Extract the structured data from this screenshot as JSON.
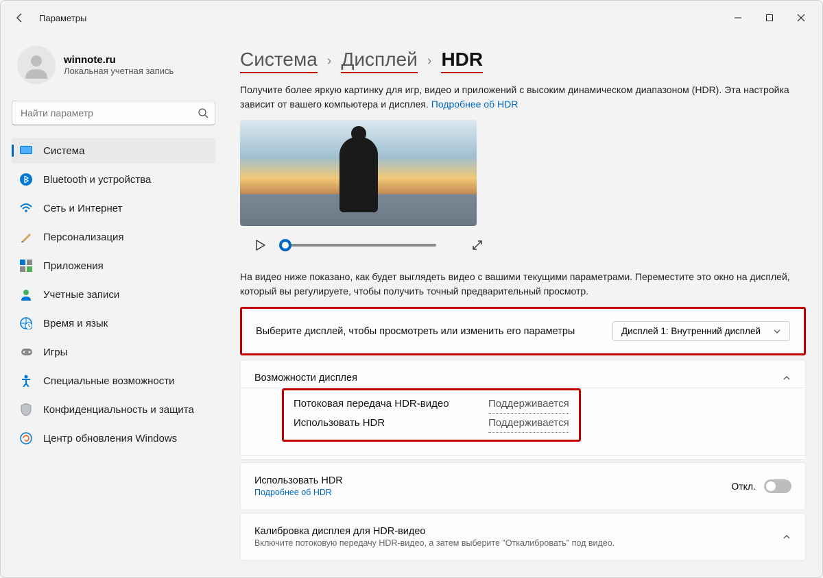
{
  "window": {
    "title": "Параметры"
  },
  "profile": {
    "name": "winnote.ru",
    "subtitle": "Локальная учетная запись"
  },
  "search": {
    "placeholder": "Найти параметр"
  },
  "nav": [
    {
      "label": "Система",
      "icon": "system"
    },
    {
      "label": "Bluetooth и устройства",
      "icon": "bluetooth"
    },
    {
      "label": "Сеть и Интернет",
      "icon": "wifi"
    },
    {
      "label": "Персонализация",
      "icon": "brush"
    },
    {
      "label": "Приложения",
      "icon": "apps"
    },
    {
      "label": "Учетные записи",
      "icon": "person"
    },
    {
      "label": "Время и язык",
      "icon": "globe-clock"
    },
    {
      "label": "Игры",
      "icon": "gamepad"
    },
    {
      "label": "Специальные возможности",
      "icon": "accessibility"
    },
    {
      "label": "Конфиденциальность и защита",
      "icon": "shield"
    },
    {
      "label": "Центр обновления Windows",
      "icon": "update"
    }
  ],
  "breadcrumb": {
    "l1": "Система",
    "l2": "Дисплей",
    "l3": "HDR"
  },
  "desc": {
    "text": "Получите более яркую картинку для игр, видео и приложений с высоким динамическом диапазоном (HDR). Эта настройка зависит от вашего компьютера и дисплея. ",
    "link": "Подробнее об HDR"
  },
  "video_hint": "На видео ниже показано, как будет выглядеть видео с вашими текущими параметрами. Переместите это окно на дисплей, который вы регулируете, чтобы получить точный предварительный просмотр.",
  "display_select": {
    "label": "Выберите дисплей, чтобы просмотреть или изменить его параметры",
    "value": "Дисплей 1: Внутренний дисплей"
  },
  "capabilities": {
    "header": "Возможности дисплея",
    "rows": [
      {
        "label": "Потоковая передача HDR-видео",
        "value": "Поддерживается"
      },
      {
        "label": "Использовать HDR",
        "value": "Поддерживается"
      }
    ]
  },
  "use_hdr": {
    "title": "Использовать HDR",
    "link": "Подробнее об HDR",
    "toggle_state": "Откл."
  },
  "calibration": {
    "title": "Калибровка дисплея для HDR-видео",
    "subtitle": "Включите потоковую передачу HDR-видео, а затем выберите \"Откалибровать\" под видео."
  }
}
